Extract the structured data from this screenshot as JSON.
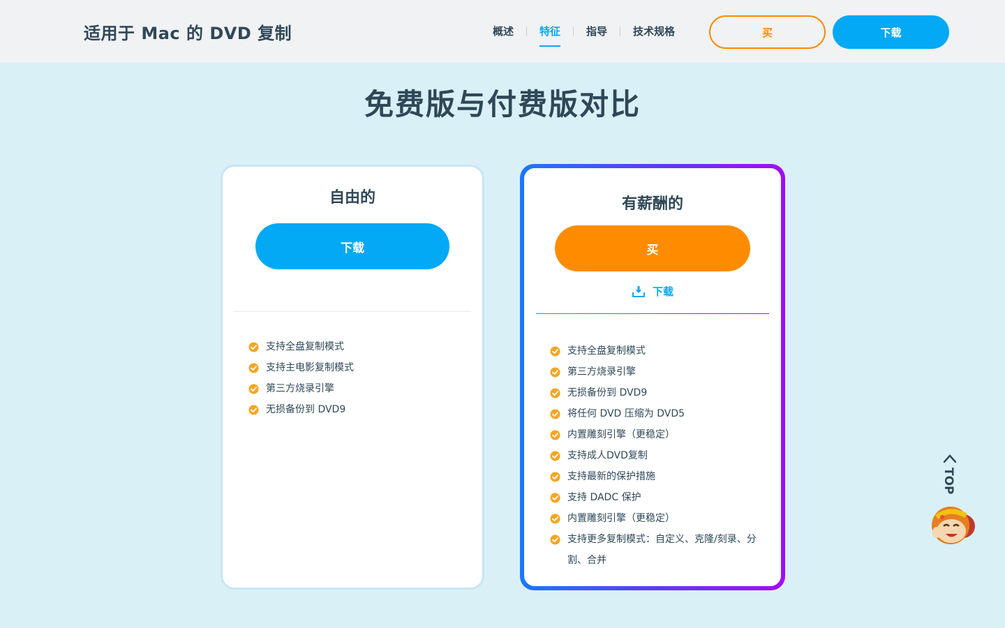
{
  "header": {
    "brand": "适用于 Mac 的 DVD 复制",
    "nav": [
      "概述",
      "特征",
      "指导",
      "技术规格"
    ],
    "active_nav": "特征",
    "buy_label": "买",
    "download_label": "下载"
  },
  "section": {
    "title": "免费版与付费版对比"
  },
  "free_card": {
    "title": "自由的",
    "button_label": "下载",
    "features": [
      "支持全盘复制模式",
      "支持主电影复制模式",
      "第三方烧录引擎",
      "无损备份到 DVD9"
    ]
  },
  "paid_card": {
    "title": "有薪酬的",
    "button_label": "买",
    "download_link": "下载",
    "features": [
      "支持全盘复制模式",
      "第三方烧录引擎",
      "无损备份到 DVD9",
      "将任何 DVD 压缩为 DVD5",
      "内置雕刻引擎（更稳定）",
      "支持成人DVD复制",
      "支持最新的保护措施",
      "支持 DADC 保护",
      "内置雕刻引擎（更稳定）",
      "支持更多复制模式：自定义、克隆/刻录、分割、合并"
    ]
  },
  "back_to_top": {
    "label": "TOP",
    "icon": "monkey-mascot-icon"
  },
  "colors": {
    "accent_blue": "#03a9f4",
    "accent_orange": "#ff8c00",
    "page_bg": "#d9f0f7",
    "header_bg": "#f1f2f4",
    "text_dark": "#2f4858",
    "gradient_start": "#1b78ff",
    "gradient_end": "#a40cf2",
    "check_color": "#f5a623"
  }
}
